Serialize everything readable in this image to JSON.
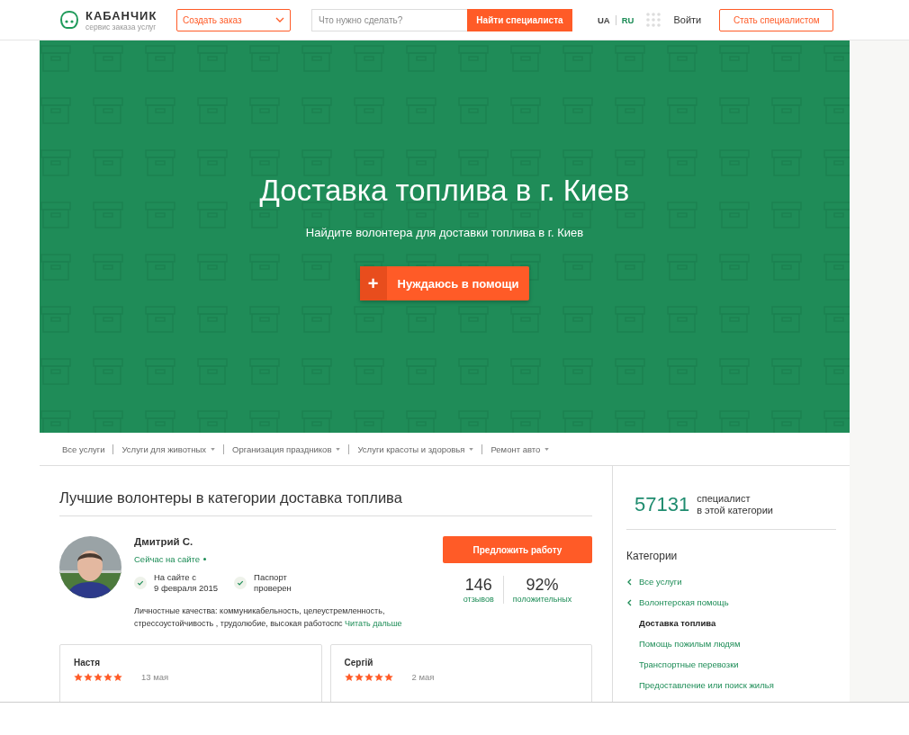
{
  "header": {
    "logo": {
      "title": "КАБАНЧИК",
      "subtitle": "сервис заказа услуг"
    },
    "create_order": {
      "label": "Создать заказ"
    },
    "search": {
      "placeholder": "Что нужно сделать?",
      "button": "Найти специалиста"
    },
    "languages": [
      {
        "label": "UA",
        "selected": false
      },
      {
        "label": "RU",
        "selected": true
      }
    ],
    "login": "Войти",
    "become_specialist": "Стать специалистом"
  },
  "hero": {
    "title": "Доставка топлива в г. Киев",
    "subtitle": "Найдите волонтера для доставки топлива в г. Киев",
    "cta": {
      "icon": "+",
      "label": "Нуждаюсь в помощи"
    }
  },
  "category_nav": [
    {
      "label": "Все услуги",
      "has_dropdown": false
    },
    {
      "label": "Услуги для животных",
      "has_dropdown": true
    },
    {
      "label": "Организация праздников",
      "has_dropdown": true
    },
    {
      "label": "Услуги красоты и здоровья",
      "has_dropdown": true
    },
    {
      "label": "Ремонт авто",
      "has_dropdown": true
    }
  ],
  "volunteers": {
    "title": "Лучшие волонтеры в категории доставка топлива",
    "specialist": {
      "name": "Дмитрий С.",
      "status": "Сейчас на сайте",
      "online": true,
      "badges": [
        {
          "label": "На сайте с",
          "value": "9 февраля 2015"
        },
        {
          "label": "Паспорт",
          "value": "проверен"
        }
      ],
      "qualities": "Личностные качества: коммуникабельность, целеустремленность, стрессоустойчивость , трудолюбие, высокая работоспс",
      "read_more": "Читать дальше",
      "offer_button": "Предложить работу",
      "stats": [
        {
          "value": "146",
          "label": "отзывов"
        },
        {
          "value": "92%",
          "label": "положительных"
        }
      ]
    },
    "reviews": [
      {
        "name": "Настя",
        "stars": 5,
        "date": "13 мая"
      },
      {
        "name": "Сергій",
        "stars": 5,
        "date": "2 мая"
      }
    ]
  },
  "sidebar": {
    "count": "57131",
    "count_label": [
      "специалист",
      "в этой категории"
    ],
    "categories_title": "Категории",
    "categories": [
      {
        "label": "Все услуги",
        "kind": "back"
      },
      {
        "label": "Волонтерская помощь",
        "kind": "back"
      },
      {
        "label": "Доставка топлива",
        "kind": "current"
      },
      {
        "label": "Помощь пожилым людям",
        "kind": "link"
      },
      {
        "label": "Транспортные перевозки",
        "kind": "link"
      },
      {
        "label": "Предоставление или поиск жилья",
        "kind": "link"
      }
    ]
  }
}
